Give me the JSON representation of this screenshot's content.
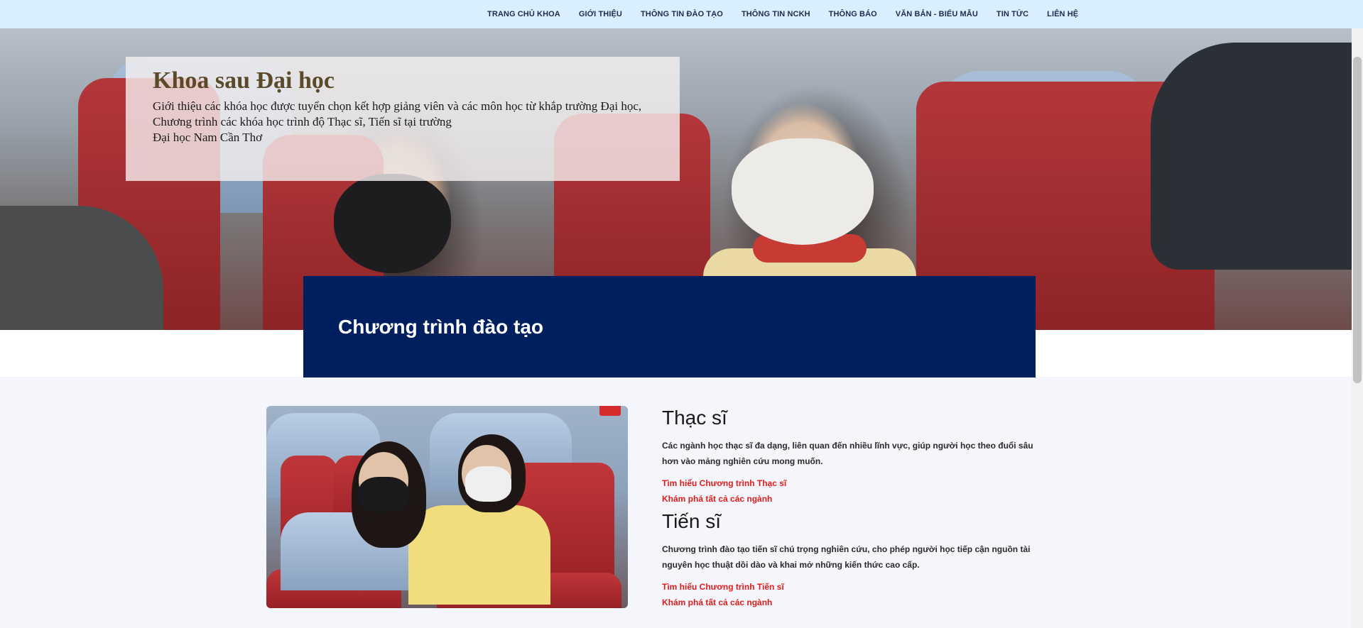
{
  "nav": {
    "items": [
      {
        "label": "TRANG CHỦ KHOA"
      },
      {
        "label": "GIỚI THIỆU"
      },
      {
        "label": "THÔNG TIN ĐÀO TẠO"
      },
      {
        "label": "THÔNG TIN NCKH"
      },
      {
        "label": "THÔNG BÁO"
      },
      {
        "label": "VĂN BẢN - BIỂU MẪU"
      },
      {
        "label": "TIN TỨC"
      },
      {
        "label": "LIÊN HỆ"
      }
    ]
  },
  "hero": {
    "title": "Khoa sau Đại học",
    "line1": "Giới thiệu các khóa học được tuyển chọn kết hợp giảng viên và các môn học từ khắp trường Đại học,",
    "line2": "Chương trình các khóa học trình độ Thạc sĩ, Tiến sĩ tại trường",
    "line3": "Đại học Nam Cần Thơ"
  },
  "program": {
    "title": "Chương trình đào tạo"
  },
  "masters": {
    "heading": "Thạc sĩ",
    "description": "Các ngành học thạc sĩ đa dạng, liên quan đến nhiều lĩnh vực, giúp người học theo đuổi sâu hơn vào mảng nghiên cứu mong muốn.",
    "link1": "Tìm hiểu Chương trình Thạc sĩ",
    "link2": "Khám phá tất cả các ngành"
  },
  "doctorate": {
    "heading": "Tiến sĩ",
    "description": "Chương trình đào tạo tiến sĩ chú trọng nghiên cứu, cho phép người học tiếp cận nguồn tài nguyên học thuật dồi dào và khai mở những kiến thức cao cấp.",
    "link1": "Tìm hiểu Chương trình Tiến sĩ",
    "link2": "Khám phá tất cả các ngành"
  },
  "colors": {
    "nav_bg": "#d9efff",
    "banner": "#001f5f",
    "link": "#e01b1b",
    "hero_title": "#5a4a2a"
  }
}
